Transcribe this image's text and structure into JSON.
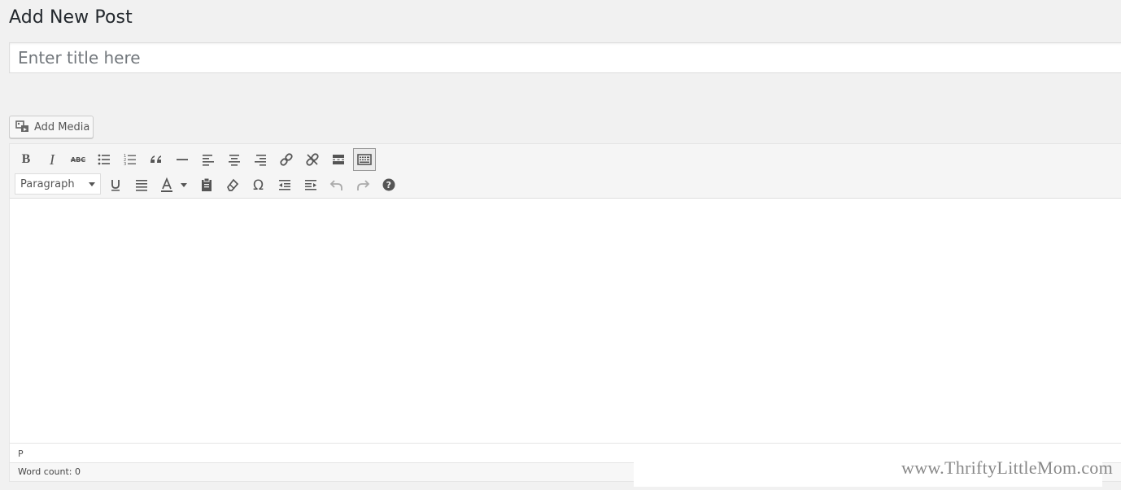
{
  "page": {
    "title": "Add New Post"
  },
  "title_field": {
    "placeholder": "Enter title here",
    "value": ""
  },
  "add_media": {
    "label": "Add Media"
  },
  "toolbar": {
    "row1": [
      {
        "name": "bold-button",
        "icon": "bold-icon"
      },
      {
        "name": "italic-button",
        "icon": "italic-icon"
      },
      {
        "name": "strikethrough-button",
        "icon": "strikethrough-icon",
        "text": "ABC"
      },
      {
        "name": "bulleted-list-button",
        "icon": "bulleted-list-icon"
      },
      {
        "name": "numbered-list-button",
        "icon": "numbered-list-icon"
      },
      {
        "name": "blockquote-button",
        "icon": "blockquote-icon"
      },
      {
        "name": "horizontal-line-button",
        "icon": "horizontal-line-icon"
      },
      {
        "name": "align-left-button",
        "icon": "align-left-icon"
      },
      {
        "name": "align-center-button",
        "icon": "align-center-icon"
      },
      {
        "name": "align-right-button",
        "icon": "align-right-icon"
      },
      {
        "name": "insert-link-button",
        "icon": "link-icon"
      },
      {
        "name": "remove-link-button",
        "icon": "unlink-icon"
      },
      {
        "name": "read-more-button",
        "icon": "read-more-icon"
      },
      {
        "name": "toolbar-toggle-button",
        "icon": "keyboard-icon",
        "active": true
      }
    ],
    "format_select": {
      "selected": "Paragraph"
    }
  },
  "statusbar": {
    "path": "P"
  },
  "word_count": {
    "label": "Word count: 0"
  },
  "watermark": {
    "text": "www.ThriftyLittleMom.com"
  }
}
